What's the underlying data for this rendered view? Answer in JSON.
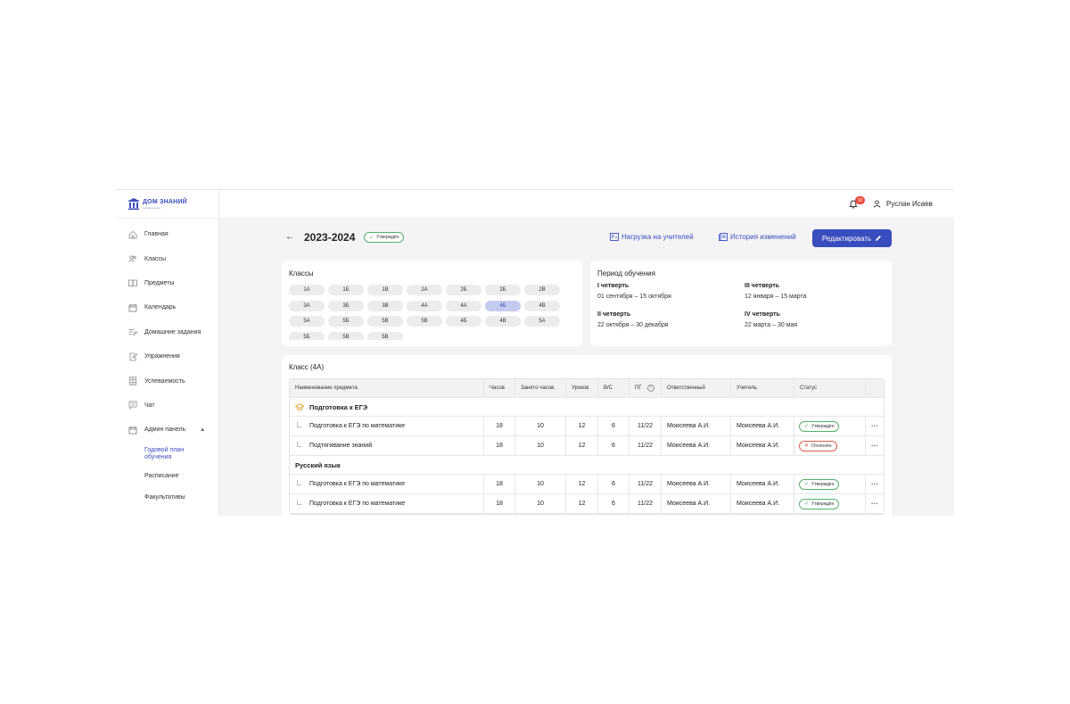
{
  "brand": {
    "name": "ДОМ ЗНАНИЙ",
    "tagline": "онлайн-школа"
  },
  "sidebar": {
    "items": [
      {
        "label": "Главная",
        "icon": "home-icon"
      },
      {
        "label": "Классы",
        "icon": "users-icon"
      },
      {
        "label": "Предметы",
        "icon": "book-icon"
      },
      {
        "label": "Календарь",
        "icon": "calendar-icon"
      },
      {
        "label": "Домашние задания",
        "icon": "list-edit-icon"
      },
      {
        "label": "Упражнения",
        "icon": "edit-icon"
      },
      {
        "label": "Успеваемость",
        "icon": "grid-icon"
      },
      {
        "label": "Чат",
        "icon": "chat-icon"
      },
      {
        "label": "Админ панель",
        "icon": "calendar-icon",
        "chevron": "▲"
      }
    ],
    "sub_items": [
      {
        "label": "Годовой план обучения",
        "active": true
      },
      {
        "label": "Расписание"
      },
      {
        "label": "Факультативы"
      }
    ]
  },
  "header": {
    "notification_count": "10",
    "user_name": "Руслан Исаев"
  },
  "page": {
    "back": "←",
    "year": "2023-2024",
    "status": "Утверждён",
    "teacher_load": "Нагрузка на учителей",
    "history": "История изменений",
    "edit": "Редактировать"
  },
  "classes": {
    "title": "Классы",
    "active": "4Б",
    "items": [
      "1А",
      "1Б",
      "1В",
      "2А",
      "2Б",
      "2Б",
      "2В",
      "3А",
      "3Б",
      "3В",
      "4А",
      "4А",
      "4Б",
      "4В",
      "5А",
      "5Б",
      "5В",
      "5В",
      "4Б",
      "4В",
      "5А",
      "5Б",
      "5В",
      "5В"
    ]
  },
  "period": {
    "title": "Период обучения",
    "quarters": [
      {
        "name": "I четверть",
        "dates": "01 сентября – 15 октября"
      },
      {
        "name": "III четверть",
        "dates": "12 января – 15 марта"
      },
      {
        "name": "II четверть",
        "dates": "22 октября – 30 декабря"
      },
      {
        "name": "IV четверть",
        "dates": "22 марта – 30 мая"
      }
    ]
  },
  "table": {
    "title": "Класс (4А)",
    "columns": [
      "Наименование предмета",
      "Часов",
      "Занято часов",
      "Уроков",
      "В/С",
      "ПГ",
      "Ответственный",
      "Учитель",
      "Статус",
      ""
    ],
    "pg_help": "?",
    "groups": [
      {
        "name": "Подготовка к ЕГЭ",
        "rows": [
          {
            "name": "Подготовка к ЕГЭ по математике",
            "hours": "18",
            "used": "10",
            "lessons": "12",
            "vs": "6",
            "pg": "11/22",
            "resp": "Моисеева А.И.",
            "teacher": "Моисеева А.И.",
            "status": "Утверждён",
            "ok": true
          },
          {
            "name": "Подтягивание знаний",
            "hours": "18",
            "used": "10",
            "lessons": "12",
            "vs": "6",
            "pg": "11/22",
            "resp": "Моисеева А.И.",
            "teacher": "Моисеева А.И.",
            "status": "Отклонён",
            "ok": false
          }
        ]
      },
      {
        "name": "Русский язык",
        "rows": [
          {
            "name": "Подготовка к ЕГЭ по математике",
            "hours": "18",
            "used": "10",
            "lessons": "12",
            "vs": "6",
            "pg": "11/22",
            "resp": "Моисеева А.И.",
            "teacher": "Моисеева А.И.",
            "status": "Утверждён",
            "ok": true
          },
          {
            "name": "Подготовка к ЕГЭ по математике",
            "hours": "18",
            "used": "10",
            "lessons": "12",
            "vs": "6",
            "pg": "11/22",
            "resp": "Моисеева А.И.",
            "teacher": "Моисеева А.И.",
            "status": "Утверждён",
            "ok": true
          }
        ]
      }
    ],
    "row_menu": "···"
  },
  "colors": {
    "accent": "#3a4dbf",
    "approved": "#56b06a",
    "rejected": "#e05c50",
    "badge": "#e84a3c"
  }
}
